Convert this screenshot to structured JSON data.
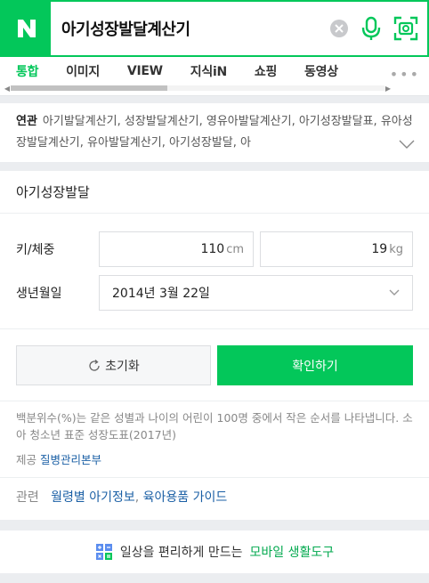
{
  "search": {
    "logo": "N",
    "query": "아기성장발달계산기",
    "icons": [
      "clear-icon",
      "mic-icon",
      "lens-icon"
    ]
  },
  "tabs": [
    {
      "label": "통합",
      "active": true
    },
    {
      "label": "이미지"
    },
    {
      "label": "VIEW"
    },
    {
      "label": "지식iN"
    },
    {
      "label": "쇼핑"
    },
    {
      "label": "동영상"
    }
  ],
  "more_label": "•••",
  "scrollbar": {
    "position_fraction": 0.0,
    "visible_fraction": 0.42
  },
  "related": {
    "label": "연관",
    "text": "아기발달계산기, 성장발달계산기, 영유아발달계산기, 아기성장발달표, 유아성장발달계산기, 유아발달계산기, 아기성장발달, 아"
  },
  "calc": {
    "title": "아기성장발달",
    "height_label": "키/체중",
    "height_value": "110",
    "height_unit": "cm",
    "weight_value": "19",
    "weight_unit": "kg",
    "birth_label": "생년월일",
    "birth_value": "2014년 3월 22일",
    "reset_label": "초기화",
    "confirm_label": "확인하기",
    "note": "백분위수(%)는 같은 성별과 나이의 어린이 100명 중에서 작은 순서를 나타냅니다. 소아 청소년 표준 성장도표(2017년)",
    "source_label": "제공",
    "source_link": "질병관리본부",
    "related_label": "관련",
    "related_link1": "월령별 아기정보",
    "related_sep": ",",
    "related_link2": "육아용품 가이드"
  },
  "footer": {
    "text": "일상을 편리하게 만드는",
    "link": "모바일 생활도구"
  },
  "colors": {
    "brand": "#03c75a",
    "link": "#1a5fa5"
  }
}
